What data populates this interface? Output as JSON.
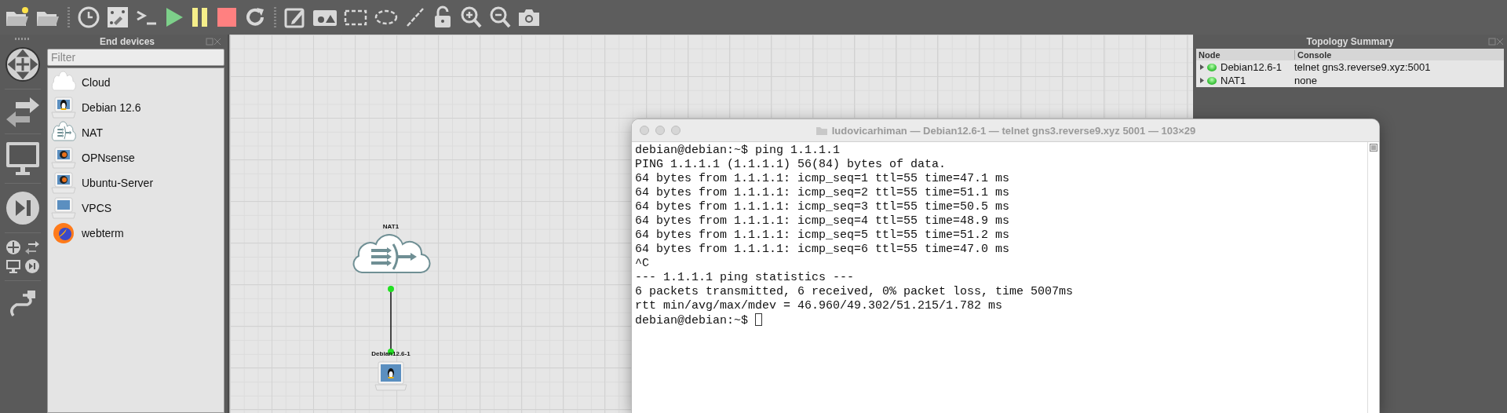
{
  "device_panel": {
    "title": "End devices",
    "filter": {
      "placeholder": "Filter"
    },
    "devices": [
      {
        "name": "Cloud",
        "kind": "cloud"
      },
      {
        "name": "Debian 12.6",
        "kind": "linux"
      },
      {
        "name": "NAT",
        "kind": "nat"
      },
      {
        "name": "OPNsense",
        "kind": "qemu"
      },
      {
        "name": "Ubuntu-Server",
        "kind": "qemu"
      },
      {
        "name": "VPCS",
        "kind": "vpcs"
      },
      {
        "name": "webterm",
        "kind": "browser"
      }
    ]
  },
  "canvas": {
    "nodes": [
      {
        "label": "NAT1",
        "kind": "nat"
      },
      {
        "label": "Debian12.6-1",
        "kind": "linux"
      }
    ]
  },
  "topology_summary": {
    "title": "Topology Summary",
    "columns": [
      "Node",
      "Console"
    ],
    "rows": [
      {
        "node": "Debian12.6-1",
        "console": "telnet gns3.reverse9.xyz:5001",
        "expanded": false
      },
      {
        "node": "NAT1",
        "console": "none",
        "expanded": false
      }
    ]
  },
  "terminal": {
    "title": "ludovicarhiman — Debian12.6-1 — telnet gns3.reverse9.xyz 5001 — 103×29",
    "cursor": true,
    "lines": [
      "debian@debian:~$ ping 1.1.1.1",
      "PING 1.1.1.1 (1.1.1.1) 56(84) bytes of data.",
      "64 bytes from 1.1.1.1: icmp_seq=1 ttl=55 time=47.1 ms",
      "64 bytes from 1.1.1.1: icmp_seq=2 ttl=55 time=51.1 ms",
      "64 bytes from 1.1.1.1: icmp_seq=3 ttl=55 time=50.5 ms",
      "64 bytes from 1.1.1.1: icmp_seq=4 ttl=55 time=48.9 ms",
      "64 bytes from 1.1.1.1: icmp_seq=5 ttl=55 time=51.2 ms",
      "64 bytes from 1.1.1.1: icmp_seq=6 ttl=55 time=47.0 ms",
      "^C",
      "--- 1.1.1.1 ping statistics ---",
      "6 packets transmitted, 6 received, 0% packet loss, time 5007ms",
      "rtt min/avg/max/mdev = 46.960/49.302/51.215/1.782 ms",
      "debian@debian:~$ "
    ]
  }
}
